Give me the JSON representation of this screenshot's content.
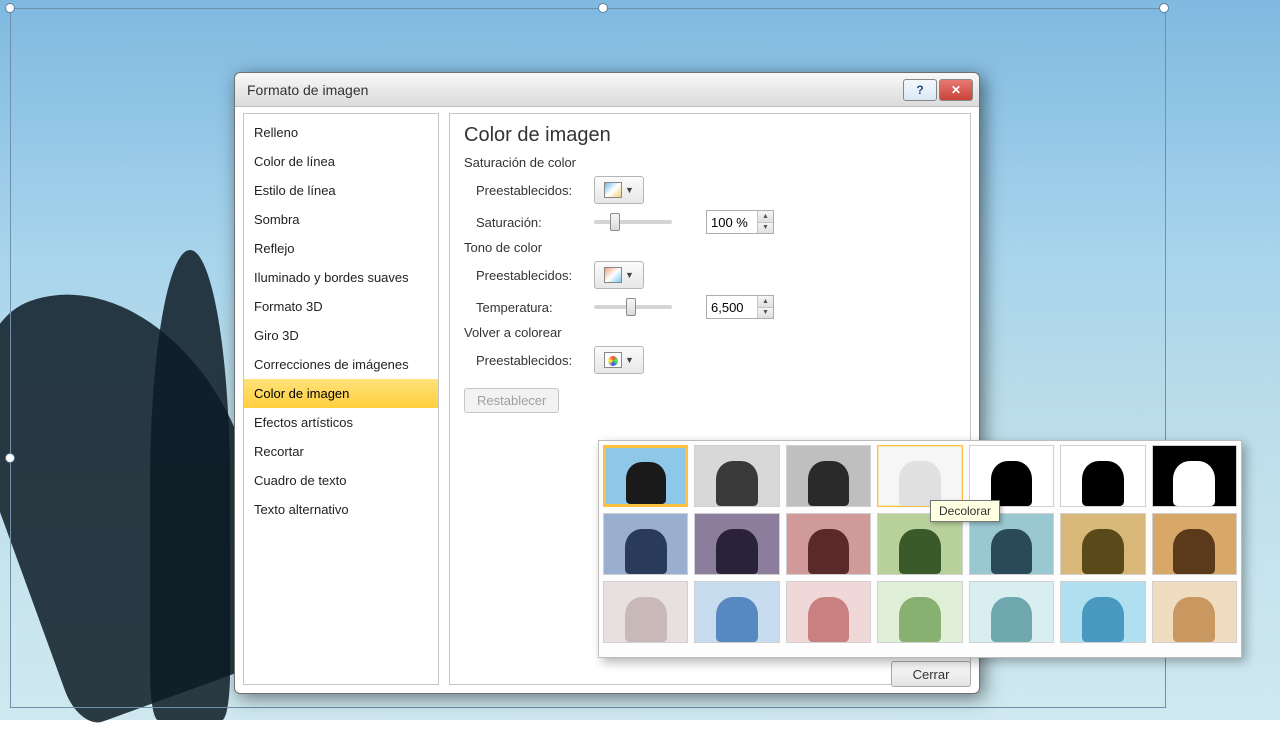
{
  "dialog": {
    "title": "Formato de imagen",
    "close_btn": "Cerrar"
  },
  "sidebar": {
    "items": [
      "Relleno",
      "Color de línea",
      "Estilo de línea",
      "Sombra",
      "Reflejo",
      "Iluminado y bordes suaves",
      "Formato 3D",
      "Giro 3D",
      "Correcciones de imágenes",
      "Color de imagen",
      "Efectos artísticos",
      "Recortar",
      "Cuadro de texto",
      "Texto alternativo"
    ],
    "selected_index": 9
  },
  "panel": {
    "heading": "Color de imagen",
    "saturation_section": "Saturación de color",
    "presets_label": "Preestablecidos:",
    "saturation_label": "Saturación:",
    "saturation_value": "100 %",
    "tone_section": "Tono de color",
    "temperature_label": "Temperatura:",
    "temperature_value": "6,500",
    "recolor_section": "Volver a colorear",
    "reset_label": "Restablecer"
  },
  "tooltip": "Decolorar",
  "recolor_thumbs": [
    {
      "bg": "#8fc7e8",
      "fg": "#1a1a1a",
      "selected": true
    },
    {
      "bg": "#d8d8d8",
      "fg": "#3a3a3a"
    },
    {
      "bg": "#bfbfbf",
      "fg": "#2a2a2a"
    },
    {
      "bg": "#f6f6f6",
      "fg": "#e0e0e0",
      "hover": true
    },
    {
      "bg": "#ffffff",
      "fg": "#000000"
    },
    {
      "bg": "#ffffff",
      "fg": "#000000"
    },
    {
      "bg": "#000000",
      "fg": "#ffffff"
    },
    {
      "bg": "#9aaed0",
      "fg": "#2a3a5a"
    },
    {
      "bg": "#8c7d9c",
      "fg": "#2a2238"
    },
    {
      "bg": "#d09a9a",
      "fg": "#5a2a2a"
    },
    {
      "bg": "#b8d09a",
      "fg": "#3a5a2a"
    },
    {
      "bg": "#9ac8d0",
      "fg": "#2a4a5a"
    },
    {
      "bg": "#d8b878",
      "fg": "#5a4a1a"
    },
    {
      "bg": "#d8a868",
      "fg": "#5a3a1a"
    },
    {
      "bg": "#e8e0e0",
      "fg": "#c8b8b8"
    },
    {
      "bg": "#c8dcf0",
      "fg": "#5888c0"
    },
    {
      "bg": "#f0d8d8",
      "fg": "#c88080"
    },
    {
      "bg": "#e0f0d8",
      "fg": "#88b070"
    },
    {
      "bg": "#d8eef0",
      "fg": "#70a8b0"
    },
    {
      "bg": "#b0e0f0",
      "fg": "#4898c0"
    },
    {
      "bg": "#f0dcc0",
      "fg": "#c89860"
    }
  ]
}
